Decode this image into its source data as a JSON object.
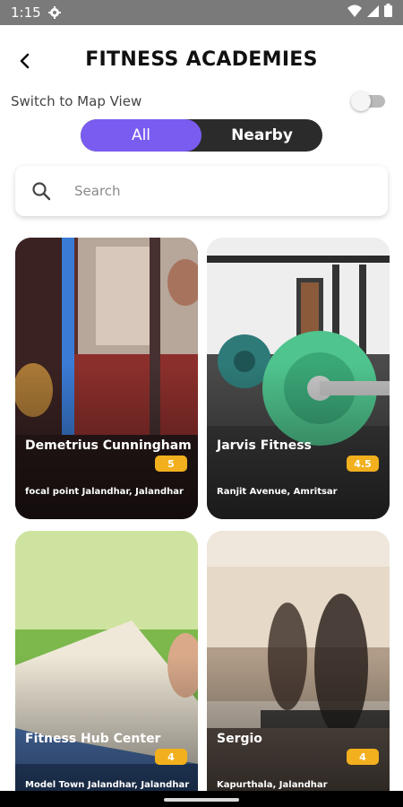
{
  "status_bar": {
    "time": "1:15"
  },
  "header": {
    "title": "FITNESS ACADEMIES"
  },
  "map_switch": {
    "label": "Switch to Map View",
    "enabled": false
  },
  "segments": {
    "all": "All",
    "nearby": "Nearby",
    "active": "all"
  },
  "search": {
    "placeholder": "Search",
    "value": ""
  },
  "academies": [
    {
      "name": "Demetrius Cunningham",
      "rating": "5",
      "address": "focal point Jalandhar, Jalandhar"
    },
    {
      "name": "Jarvis Fitness",
      "rating": "4.5",
      "address": "Ranjit Avenue, Amritsar"
    },
    {
      "name": "Fitness Hub Center",
      "rating": "4",
      "address": "Model Town Jalandhar, Jalandhar"
    },
    {
      "name": "Sergio",
      "rating": "4",
      "address": "Kapurthala, Jalandhar"
    }
  ],
  "colors": {
    "accent": "#7b5cf0",
    "rating_badge": "#f2b01e",
    "segment_bg": "#2b2b2b",
    "status_bar": "#7a7a7a"
  }
}
